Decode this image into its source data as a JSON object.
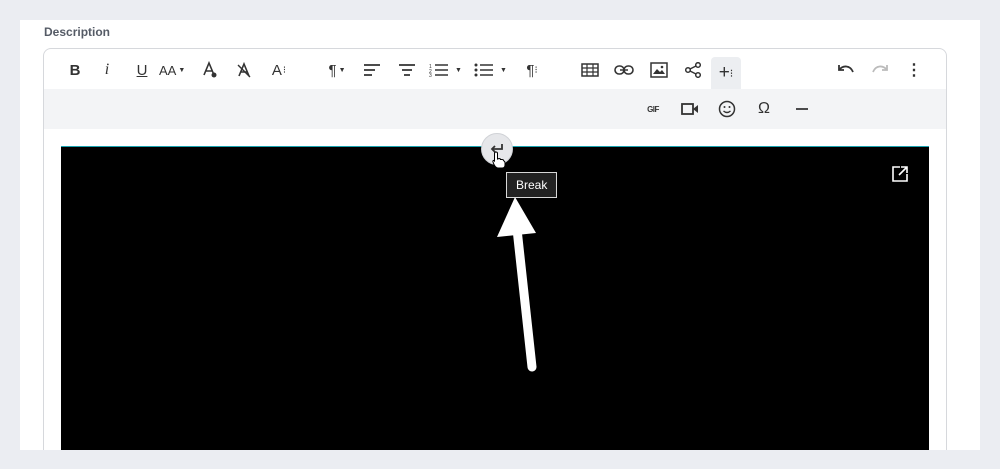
{
  "section": {
    "label": "Description"
  },
  "toolbar": {
    "bold": "B",
    "italic": "i",
    "underline": "U",
    "font_size": "AA",
    "text_style": "A",
    "more_label": "+",
    "special_char": "Ω",
    "gif": "GIF"
  },
  "tooltip": {
    "text": "Break"
  },
  "colors": {
    "accent": "#1aa2b0",
    "video_bg": "#000000",
    "toolbar_bg": "#f3f4f6"
  }
}
